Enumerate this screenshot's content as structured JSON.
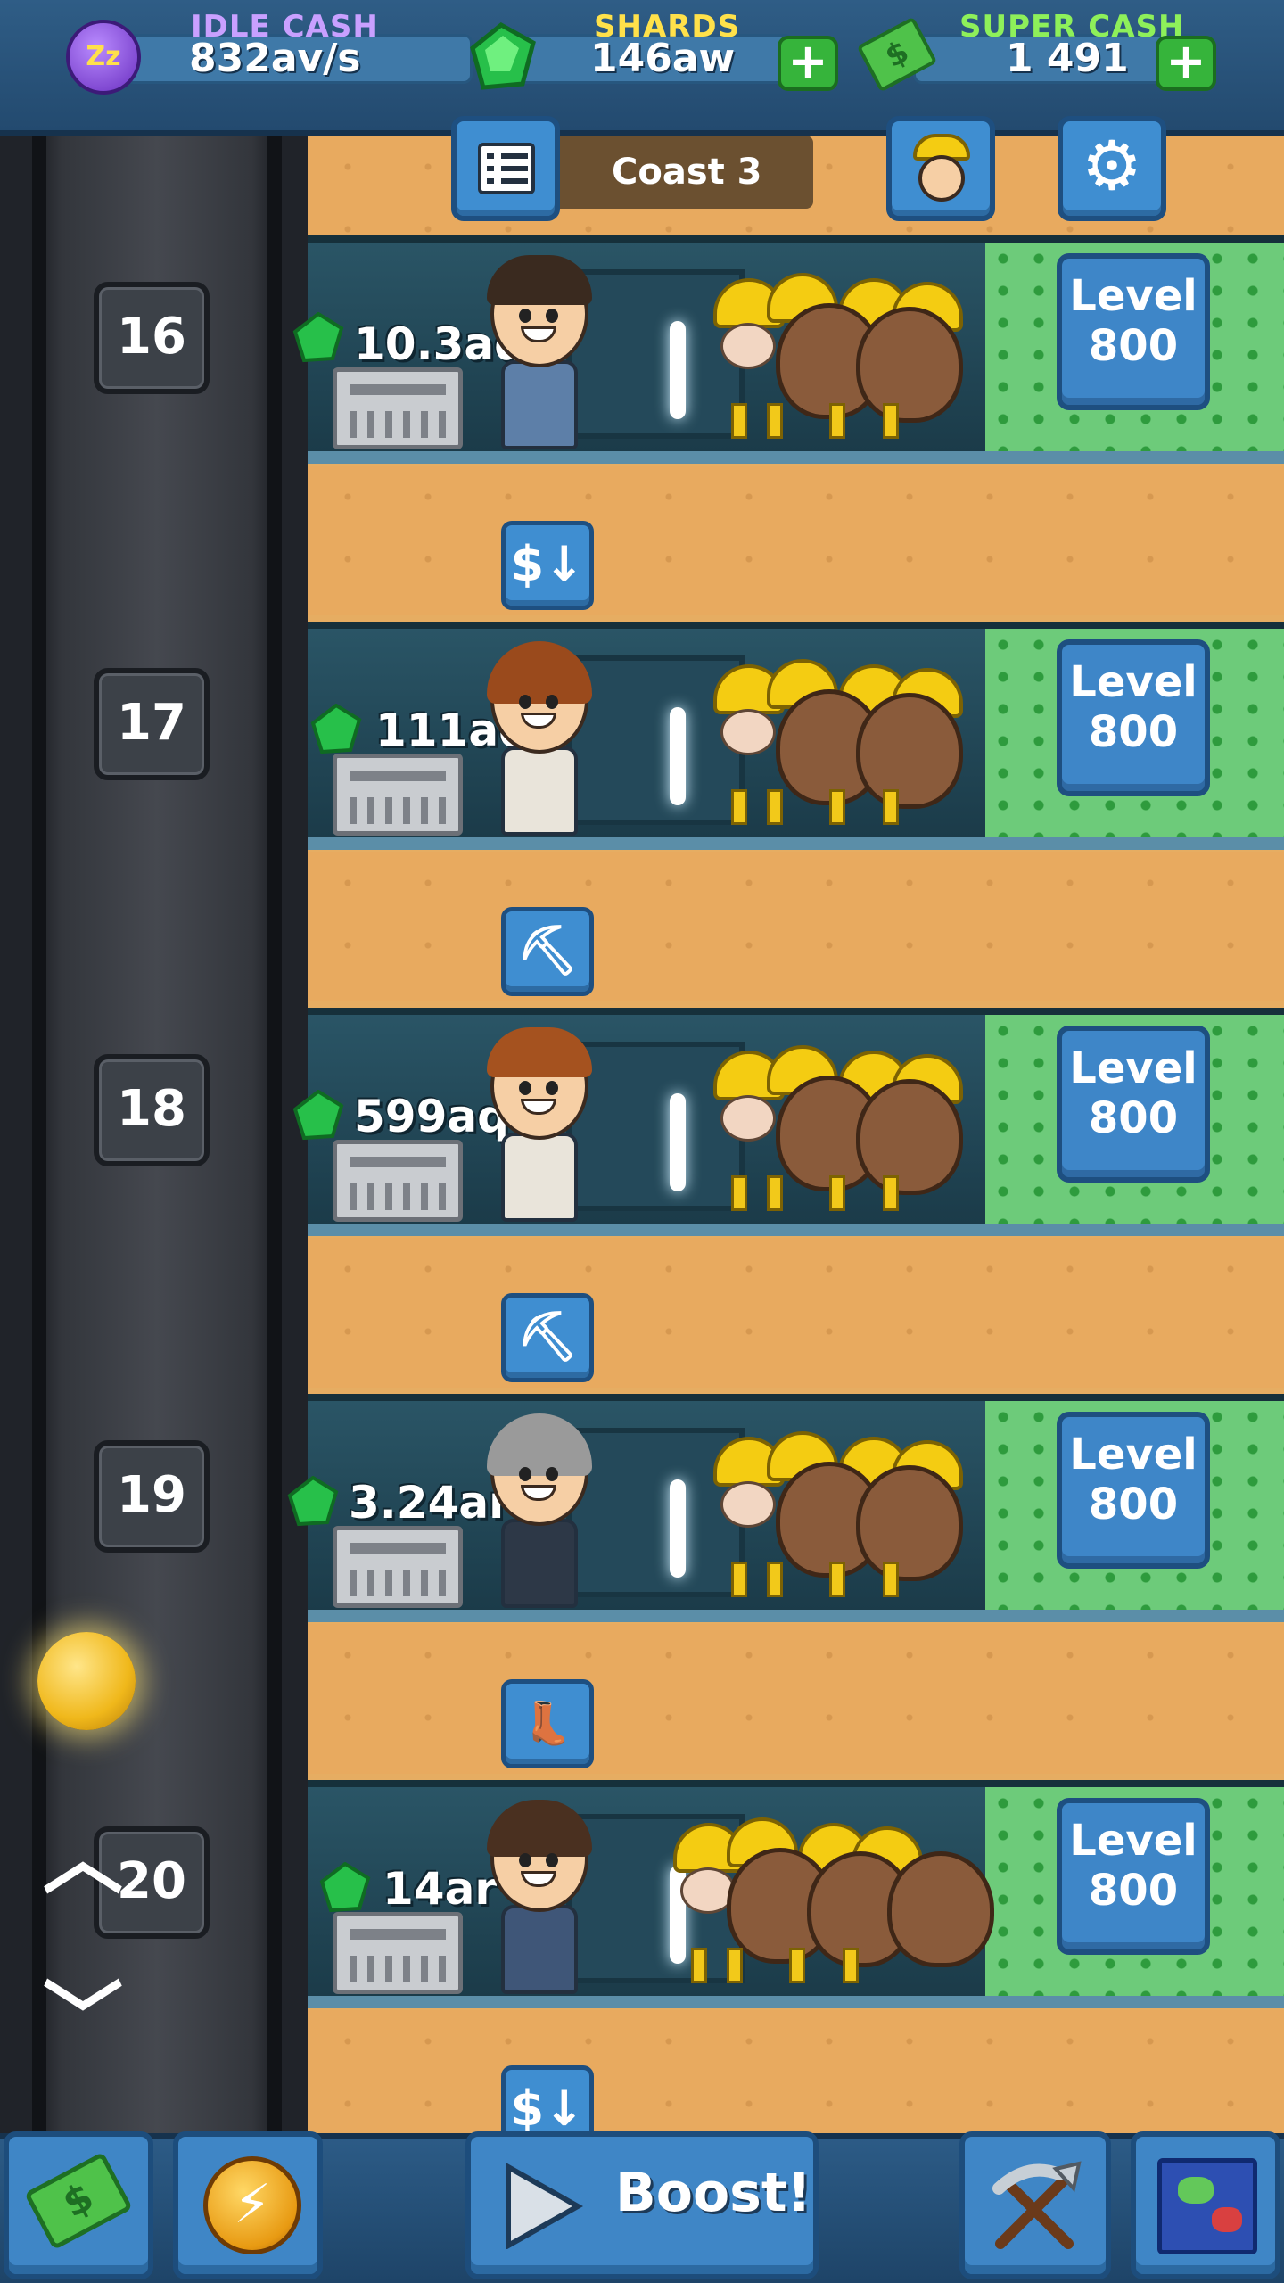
{
  "topbar": {
    "idle_cash": {
      "label": "IDLE CASH",
      "value": "832av/s",
      "label_color": "#c9a0ff",
      "icon": "sleep-coin-icon"
    },
    "shards": {
      "label": "SHARDS",
      "value": "146aw",
      "label_color": "#ffe14a",
      "icon": "green-shard-icon"
    },
    "super_cash": {
      "label": "SUPER CASH",
      "value": "1 491",
      "label_color": "#8ef05a",
      "icon": "super-cash-stack-icon"
    },
    "plus_label": "+"
  },
  "header": {
    "mine_name": "Coast 3",
    "list_icon": "task-list-icon",
    "manager_icon": "manager-portrait-icon",
    "settings_icon": "gear-icon"
  },
  "shafts": [
    {
      "number": "16",
      "amount": "10.3aq",
      "level_label": "Level",
      "level_value": "800",
      "manager_hair": "#3a2a1f",
      "manager_suit": "#5d7fa8"
    },
    {
      "number": "17",
      "amount": "111aq",
      "level_label": "Level",
      "level_value": "800",
      "manager_hair": "#9a4a1c",
      "manager_suit": "#e9e4da"
    },
    {
      "number": "18",
      "amount": "599aq",
      "level_label": "Level",
      "level_value": "800",
      "manager_hair": "#a5521f",
      "manager_suit": "#e9e4da"
    },
    {
      "number": "19",
      "amount": "3.24ar",
      "level_label": "Level",
      "level_value": "800",
      "manager_hair": "#9a9a9a",
      "manager_suit": "#2d3847"
    },
    {
      "number": "20",
      "amount": "14ar",
      "level_label": "Level",
      "level_value": "800",
      "manager_hair": "#4a3020",
      "manager_suit": "#3f5678"
    }
  ],
  "action_buttons": [
    {
      "icon": "cash-down-icon",
      "glyph": "$↓"
    },
    {
      "icon": "pickaxe-icon",
      "glyph": "⛏"
    },
    {
      "icon": "pickaxe-icon",
      "glyph": "⛏"
    },
    {
      "icon": "boot-icon",
      "glyph": "👢"
    },
    {
      "icon": "cash-down-icon",
      "glyph": "$↓"
    }
  ],
  "elevator": {
    "up_icon": "chevron-up-icon",
    "down_icon": "chevron-down-icon",
    "up_glyph": "︿",
    "down_glyph": "﹀"
  },
  "bottombar": {
    "shop_icon": "cash-stack-icon",
    "boost_coin_icon": "lightning-coin-icon",
    "boost_label": "Boost!",
    "boost_icon": "play-arrow-icon",
    "tools_icon": "pickaxe-shovel-icon",
    "map_icon": "world-map-icon"
  }
}
